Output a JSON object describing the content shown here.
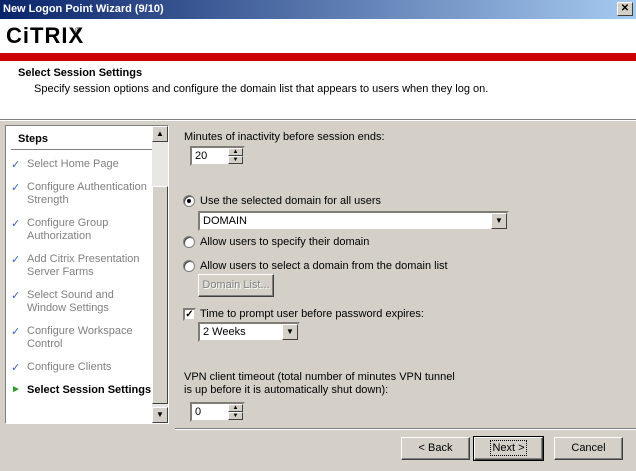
{
  "window": {
    "title": "New Logon Point Wizard (9/10)",
    "close_glyph": "✕"
  },
  "header": {
    "logo_text": "CiTRIX",
    "logo_tm": "®",
    "title": "Select Session Settings",
    "description": "Specify session options and configure the domain list that appears to users when they log on.",
    "accent_color": "#cc0000"
  },
  "steps": {
    "heading": "Steps",
    "items": [
      {
        "label": "Select Home Page",
        "status": "done"
      },
      {
        "label": "Configure Authentication Strength",
        "status": "done"
      },
      {
        "label": "Configure Group Authorization",
        "status": "done"
      },
      {
        "label": "Add Citrix Presentation Server Farms",
        "status": "done"
      },
      {
        "label": "Select Sound and Window Settings",
        "status": "done"
      },
      {
        "label": "Configure Workspace Control",
        "status": "done"
      },
      {
        "label": "Configure Clients",
        "status": "done"
      },
      {
        "label": "Select Session Settings",
        "status": "current"
      }
    ],
    "done_mark": "✓",
    "current_mark": "►"
  },
  "form": {
    "inactivity_label": "Minutes of inactivity before session ends:",
    "inactivity_value": "20",
    "radio_selected_domain": "Use the selected domain for all users",
    "domain_value": "DOMAIN",
    "radio_specify_domain": "Allow users to specify their domain",
    "radio_domain_list": "Allow users to select a domain from the domain list",
    "domain_list_button": "Domain List...",
    "password_prompt_label": "Time to prompt user before password expires:",
    "password_prompt_checked": true,
    "password_prompt_value": "2 Weeks",
    "vpn_label_line1": "VPN client timeout (total number of minutes VPN tunnel",
    "vpn_label_line2": "is up before it is automatically shut down):",
    "vpn_value": "0",
    "selected_radio": "use_selected_domain"
  },
  "buttons": {
    "back": "< Back",
    "next": "Next >",
    "cancel": "Cancel"
  }
}
